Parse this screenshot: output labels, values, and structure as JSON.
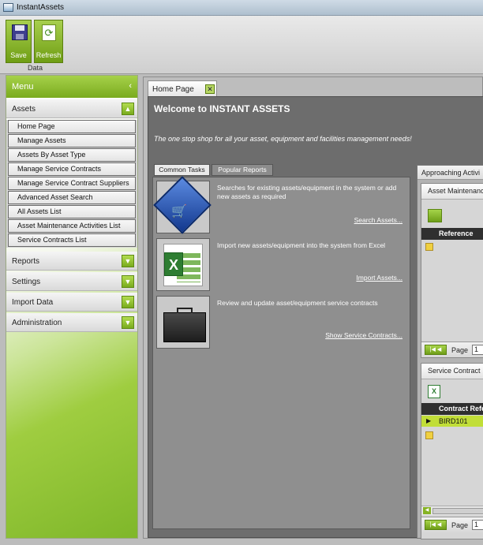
{
  "window": {
    "title": "InstantAssets"
  },
  "ribbon": {
    "save_label": "Save",
    "refresh_label": "Refresh",
    "group_label": "Data"
  },
  "sidebar": {
    "menu_title": "Menu",
    "collapse_glyph": "‹",
    "sections": {
      "assets": "Assets",
      "reports": "Reports",
      "settings": "Settings",
      "import_data": "Import Data",
      "administration": "Administration"
    },
    "asset_items": [
      "Home Page",
      "Manage Assets",
      "Assets By Asset Type",
      "Manage Service Contracts",
      "Manage Service Contract Suppliers",
      "Advanced Asset Search",
      "All Assets List",
      "Asset Maintenance Activities List",
      "Service Contracts List"
    ]
  },
  "content": {
    "tab_label": "Home Page",
    "welcome_title": "Welcome to INSTANT ASSETS",
    "tagline": "The one stop shop for all your asset, equipment and facilities management needs!",
    "tabs": {
      "common": "Common Tasks",
      "popular": "Popular Reports"
    },
    "tasks": [
      {
        "description": "Searches for existing assets/equipment in the system or add new assets as required",
        "link": "Search Assets...",
        "icon": "shopping-cart-icon"
      },
      {
        "description": "Import new assets/equipment into the system from Excel",
        "link": "Import Assets...",
        "icon": "excel-icon"
      },
      {
        "description": "Review and update asset/equipment service contracts",
        "link": "Show Service Contracts...",
        "icon": "briefcase-icon"
      }
    ],
    "approaching": {
      "header": "Approaching Activi",
      "maintenance": {
        "title": "Asset Maintenanc",
        "column": "Reference",
        "page_label": "Page",
        "page_value": "1"
      },
      "contracts": {
        "title": "Service Contract",
        "column": "Contract Refe",
        "row": "BIRD101",
        "page_label": "Page",
        "page_value": "1"
      }
    }
  },
  "colors": {
    "accent": "#8cc032",
    "panel": "#6d6d6d"
  }
}
